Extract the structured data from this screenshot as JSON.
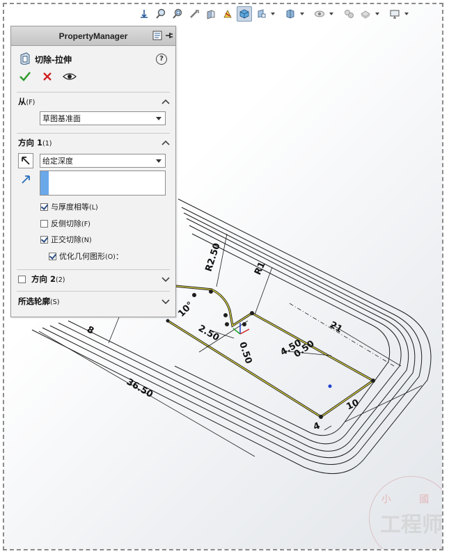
{
  "property_manager": {
    "header_title": "PropertyManager",
    "feature_title": "切除-拉伸",
    "help": "?",
    "from_section": {
      "title": "从",
      "shortcut": "(F)",
      "selected": "草图基准面"
    },
    "direction1": {
      "title": "方向 1",
      "shortcut": "(1)",
      "end_condition": "给定深度",
      "options": [
        {
          "label": "与厚度相等",
          "shortcut": "(L)",
          "checked": true
        },
        {
          "label": "反侧切除",
          "shortcut": "(F)",
          "checked": false
        },
        {
          "label": "正交切除",
          "shortcut": "(N)",
          "checked": true
        }
      ],
      "sub_option": {
        "label": "优化几何图形",
        "shortcut": "(O)",
        "suffix": "：",
        "checked": true
      }
    },
    "direction2": {
      "title": "方向 2",
      "shortcut": "(2)",
      "checked": false
    },
    "selected_contours": {
      "title": "所选轮廓",
      "shortcut": "(S)"
    }
  },
  "toolbar_icons": [
    "view-orientation-icon",
    "zoom-to-fit-icon",
    "zoom-area-icon",
    "previous-view-icon",
    "section-view-icon",
    "dynamic-annotation-icon",
    "view-orientation-cube-icon",
    "display-style-icon",
    "hide-show-items-icon",
    "edit-appearance-icon",
    "apply-scene-icon",
    "view-settings-icon",
    "display-monitor-icon"
  ],
  "dimensions": [
    "R2.50",
    "R1",
    "10°",
    "2.50",
    "0.50",
    "4.50",
    "0.50",
    "21",
    "8",
    "36.50",
    "10",
    "4"
  ],
  "watermark": {
    "top": "小 國",
    "main": "工程师"
  },
  "colors": {
    "highlight_edge": "#e8e04a",
    "accent_blue": "#2a6ebb",
    "pm_bg": "#f2f2f2"
  }
}
